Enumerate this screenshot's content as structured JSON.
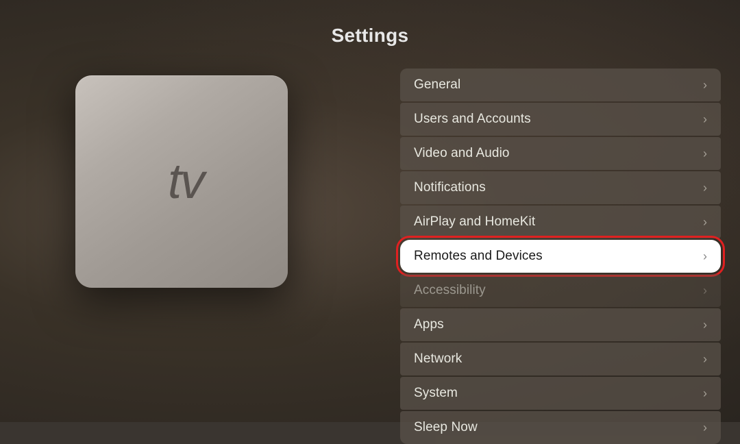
{
  "page": {
    "title": "Settings"
  },
  "appletv": {
    "apple_symbol": "",
    "tv_text": "tv"
  },
  "settings_items": [
    {
      "id": "general",
      "label": "General",
      "highlighted": false,
      "dimmed": false
    },
    {
      "id": "users-and-accounts",
      "label": "Users and Accounts",
      "highlighted": false,
      "dimmed": false
    },
    {
      "id": "video-and-audio",
      "label": "Video and Audio",
      "highlighted": false,
      "dimmed": false
    },
    {
      "id": "notifications",
      "label": "Notifications",
      "highlighted": false,
      "dimmed": false
    },
    {
      "id": "airplay-and-homekit",
      "label": "AirPlay and HomeKit",
      "highlighted": false,
      "dimmed": false
    },
    {
      "id": "remotes-and-devices",
      "label": "Remotes and Devices",
      "highlighted": true,
      "dimmed": false
    },
    {
      "id": "accessibility",
      "label": "Accessibility",
      "highlighted": false,
      "dimmed": true
    },
    {
      "id": "apps",
      "label": "Apps",
      "highlighted": false,
      "dimmed": false
    },
    {
      "id": "network",
      "label": "Network",
      "highlighted": false,
      "dimmed": false
    },
    {
      "id": "system",
      "label": "System",
      "highlighted": false,
      "dimmed": false
    },
    {
      "id": "sleep-now",
      "label": "Sleep Now",
      "highlighted": false,
      "dimmed": false
    }
  ]
}
